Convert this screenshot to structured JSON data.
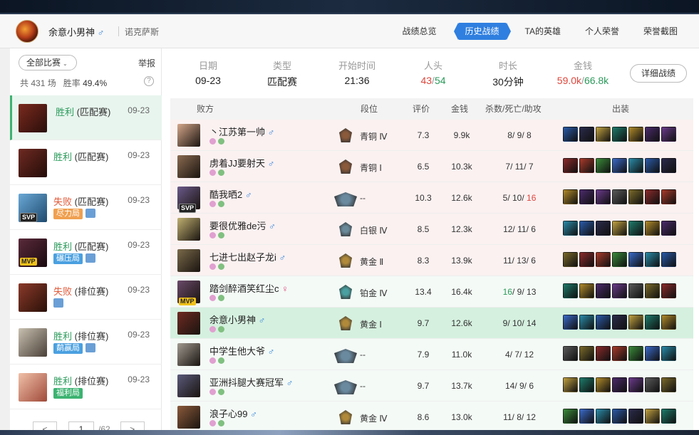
{
  "header": {
    "player_name": "余意小男神",
    "gender_symbol": "♂",
    "server": "诺克萨斯",
    "tabs": [
      {
        "label": "战绩总览",
        "active": false
      },
      {
        "label": "历史战绩",
        "active": true
      },
      {
        "label": "TA的英雄",
        "active": false
      },
      {
        "label": "个人荣誉",
        "active": false
      },
      {
        "label": "荣誉截图",
        "active": false
      }
    ]
  },
  "sidebar": {
    "filter": "全部比赛",
    "report": "举报",
    "total_prefix": "共",
    "total_games": "431",
    "games_unit": "场",
    "winrate_label": "胜率",
    "winrate": "49.4%",
    "help": "?",
    "matches": [
      {
        "result": "胜利",
        "outcome": "win",
        "mode": "(匹配赛)",
        "date": "09-23",
        "tag": "",
        "badge": "",
        "color": "#7a2a1e"
      },
      {
        "result": "胜利",
        "outcome": "win",
        "mode": "(匹配赛)",
        "date": "09-23",
        "tag": "",
        "badge": "",
        "color": "#6e2a22"
      },
      {
        "result": "失败",
        "outcome": "loss",
        "mode": "(匹配赛)",
        "date": "09-23",
        "tag": "尽力局",
        "tag_color": "#f0a050",
        "badge": "SVP",
        "color": "#4a88b6"
      },
      {
        "result": "胜利",
        "outcome": "win",
        "mode": "(匹配赛)",
        "date": "09-23",
        "tag": "碾压局",
        "tag_color": "#4aa0e0",
        "badge": "MVP",
        "color": "#5a2a3a"
      },
      {
        "result": "失败",
        "outcome": "loss",
        "mode": "(排位赛)",
        "date": "09-23",
        "tag": "",
        "badge": "",
        "color": "#8a3a2a"
      },
      {
        "result": "胜利",
        "outcome": "win",
        "mode": "(排位赛)",
        "date": "09-23",
        "tag": "鹬赢局",
        "tag_color": "#4aa0e0",
        "badge": "",
        "color": "#8a8070"
      },
      {
        "result": "胜利",
        "outcome": "win",
        "mode": "(排位赛)",
        "date": "09-23",
        "tag": "福利局",
        "tag_color": "#3cb371",
        "badge": "",
        "color": "#c8806a"
      }
    ],
    "pager": {
      "prev": "<",
      "current": "1",
      "total": "/62",
      "next": ">"
    }
  },
  "summary": {
    "date_label": "日期",
    "date": "09-23",
    "type_label": "类型",
    "type": "匹配赛",
    "start_label": "开始时间",
    "start": "21:36",
    "kills_label": "人头",
    "kills_loss": "43",
    "kills_sep": "/",
    "kills_win": "54",
    "duration_label": "时长",
    "duration": "30分钟",
    "gold_label": "金钱",
    "gold_loss": "59.0k",
    "gold_sep": "/",
    "gold_win": "66.8k",
    "detail_button": "详细战绩"
  },
  "table": {
    "headers": {
      "side": "败方",
      "rank": "段位",
      "score": "评价",
      "gold": "金钱",
      "kda": "杀数/死亡/助攻",
      "items": "出装"
    },
    "rows": [
      {
        "name": "丶江苏第一帅",
        "gender": "♂",
        "team": "loss",
        "rank": "青铜 Ⅳ",
        "score": "7.3",
        "gold": "9.9k",
        "k": "8",
        "d": "9",
        "a": "8",
        "champ": "#d4a68a",
        "badge": "",
        "icon": "bronze"
      },
      {
        "name": "虏着JJ要射天",
        "gender": "♂",
        "team": "loss",
        "rank": "青铜 Ⅰ",
        "score": "6.5",
        "gold": "10.3k",
        "k": "7",
        "d": "11",
        "a": "7",
        "champ": "#8a6a50",
        "badge": "",
        "icon": "bronze"
      },
      {
        "name": "酷我晒2",
        "gender": "♂",
        "team": "loss",
        "rank": "--",
        "score": "10.3",
        "gold": "12.6k",
        "k": "5",
        "d": "10",
        "a": "16",
        "champ": "#6a5a8a",
        "badge": "SVP",
        "icon": "wide",
        "a_red": true
      },
      {
        "name": "要很优雅de污",
        "gender": "♂",
        "team": "loss",
        "rank": "白银 Ⅳ",
        "score": "8.5",
        "gold": "12.3k",
        "k": "12",
        "d": "11",
        "a": "6",
        "champ": "#c0b070",
        "badge": "",
        "icon": "silver"
      },
      {
        "name": "七进七出赵子龙i",
        "gender": "♂",
        "team": "loss",
        "rank": "黄金 Ⅱ",
        "score": "8.3",
        "gold": "13.9k",
        "k": "11",
        "d": "13",
        "a": "6",
        "champ": "#7a6a4a",
        "badge": "",
        "icon": "gold"
      },
      {
        "name": "踏剑醉酒笑红尘c",
        "gender": "♀",
        "team": "win",
        "rank": "铂金 Ⅳ",
        "score": "13.4",
        "gold": "16.4k",
        "k": "16",
        "d": "9",
        "a": "13",
        "champ": "#6a4a6a",
        "badge": "MVP",
        "icon": "plat",
        "green": true
      },
      {
        "name": "余意小男神",
        "gender": "♂",
        "team": "self",
        "rank": "黄金 Ⅰ",
        "score": "9.7",
        "gold": "12.6k",
        "k": "9",
        "d": "10",
        "a": "14",
        "champ": "#6e2a22",
        "badge": "",
        "icon": "gold"
      },
      {
        "name": "中学生他大爷",
        "gender": "♂",
        "team": "win",
        "rank": "--",
        "score": "7.9",
        "gold": "11.0k",
        "k": "4",
        "d": "7",
        "a": "12",
        "champ": "#a09a90",
        "badge": "",
        "icon": "wide"
      },
      {
        "name": "亚洲抖腿大赛冠军",
        "gender": "♂",
        "team": "win",
        "rank": "--",
        "score": "9.7",
        "gold": "13.7k",
        "k": "14",
        "d": "9",
        "a": "6",
        "champ": "#5a5a7a",
        "badge": "",
        "icon": "wide"
      },
      {
        "name": "浪子心99",
        "gender": "♂",
        "team": "win",
        "rank": "黄金 Ⅳ",
        "score": "8.6",
        "gold": "13.0k",
        "k": "11",
        "d": "8",
        "a": "12",
        "champ": "#8a5a3a",
        "badge": "",
        "icon": "gold"
      }
    ]
  }
}
